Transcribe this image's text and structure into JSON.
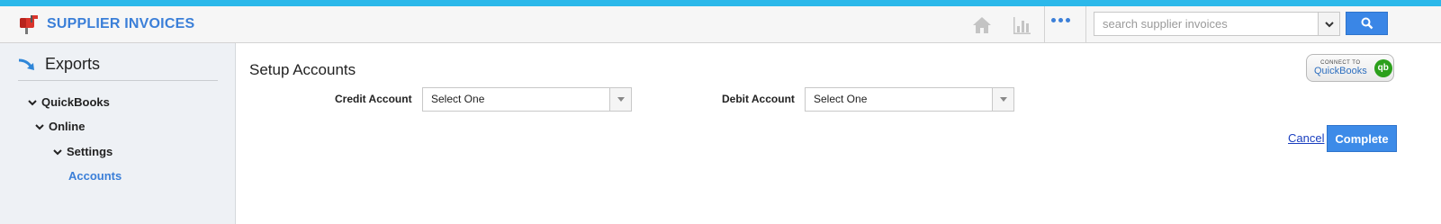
{
  "header": {
    "title": "SUPPLIER INVOICES",
    "search_placeholder": "search supplier invoices"
  },
  "sidebar": {
    "heading": "Exports",
    "tree": [
      {
        "label": "QuickBooks"
      },
      {
        "label": "Online"
      },
      {
        "label": "Settings"
      }
    ],
    "active_link": "Accounts"
  },
  "main": {
    "title": "Setup Accounts",
    "credit_label": "Credit Account",
    "credit_value": "Select One",
    "debit_label": "Debit Account",
    "debit_value": "Select One",
    "qb_badge_small": "CONNECT TO",
    "qb_badge_big": "QuickBooks",
    "qb_logo": "qb",
    "cancel_label": "Cancel",
    "complete_label": "Complete"
  },
  "colors": {
    "accent": "#3b7fd8",
    "top_stripe": "#2bb8ea",
    "qb_green": "#2ca01c"
  }
}
